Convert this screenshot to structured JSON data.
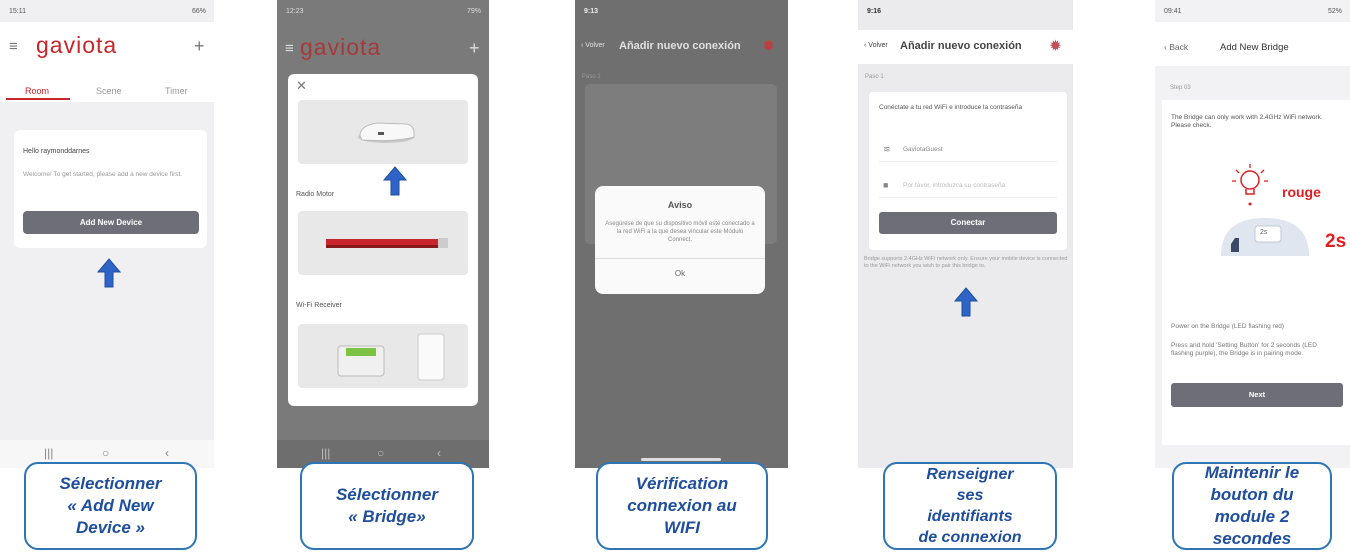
{
  "colors": {
    "brand_red": "#c8252c",
    "caption_blue": "#1f4e9c",
    "arrow_blue": "#2e64c8",
    "button_gray": "#6e6e78",
    "annotation_red": "#e02020"
  },
  "screen1": {
    "status_time": "15:11",
    "status_right": "66%",
    "logo": "gaviota",
    "tabs": [
      "Room",
      "Scene",
      "Timer"
    ],
    "hello": "Hello raymonddarnes",
    "welcome": "Welcome! To get started, please add a new device first.",
    "button": "Add New Device",
    "caption": "Sélectionner\n« Add New\nDevice »"
  },
  "screen2": {
    "status_time": "12:23",
    "status_right": "79%",
    "logo": "gaviota",
    "labels": [
      "Radio Motor",
      "Wi-Fi Receiver"
    ],
    "caption": "Sélectionner\n« Bridge»"
  },
  "screen3": {
    "status_time": "9:13",
    "back": "Volver",
    "title": "Añadir nuevo conexión",
    "step": "Paso 1",
    "dialog_title": "Aviso",
    "dialog_message": "Asegúrese de que su dispositivo móvil esté conectado a la red WiFi a la que desea vincular este Módulo Connect.",
    "dialog_button": "Ok",
    "caption": "Vérification\nconnexion au\nWIFI"
  },
  "screen4": {
    "status_time": "9:16",
    "back": "Volver",
    "title": "Añadir nuevo conexión",
    "step": "Paso 1",
    "instruction": "Conéctate a tu red WiFi e introduce la contraseña",
    "wifi_name": "GaviotaGuest",
    "password_placeholder": "Por favor, introduzca su contraseña",
    "button": "Conectar",
    "note": "Bridge supports 2.4GHz WiFi network only. Ensure your mobile device is connected to the WiFi network you wish to pair this bridge to.",
    "caption": "Renseigner\nses\nidentifiants\nde connexion"
  },
  "screen5": {
    "status_time": "09:41",
    "status_right": "52%",
    "back": "Back",
    "title": "Add New Bridge",
    "step": "Step 03",
    "description": "The Bridge can only work with 2.4GHz WiFi network. Please check.",
    "rouge": "rouge",
    "hold_value": "2s",
    "hold_badge": "2s",
    "power": "Power on the Bridge (LED flashing red)",
    "press": "Press and hold 'Setting Button' for 2 seconds (LED flashing purple), the Bridge is in pairing mode.",
    "button": "Next",
    "caption": "Maintenir le\nbouton du\nmodule 2\nsecondes"
  }
}
